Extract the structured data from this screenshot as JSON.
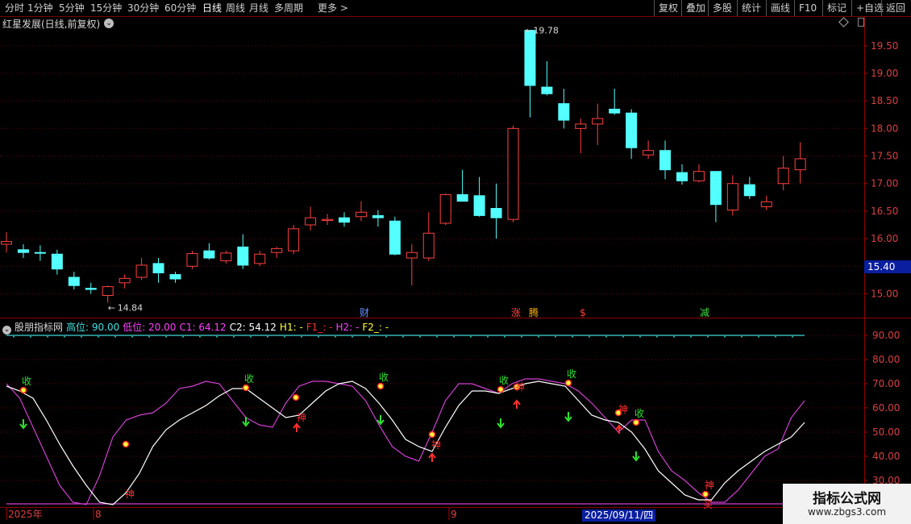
{
  "toolbar": {
    "periods": [
      {
        "label": "分时"
      },
      {
        "label": "1分钟"
      },
      {
        "label": "5分钟"
      },
      {
        "label": "15分钟"
      },
      {
        "label": "30分钟"
      },
      {
        "label": "60分钟"
      },
      {
        "label": "日线",
        "active": true
      },
      {
        "label": "周线"
      },
      {
        "label": "月线"
      },
      {
        "label": "多周期"
      },
      {
        "label": "更多 >"
      }
    ],
    "actions": [
      {
        "label": "复权"
      },
      {
        "label": "叠加"
      },
      {
        "label": "多股"
      },
      {
        "label": "统计"
      },
      {
        "label": "画线"
      },
      {
        "label": "F10"
      },
      {
        "label": "标记"
      },
      {
        "label": "+自选"
      },
      {
        "label": "返回"
      }
    ]
  },
  "stock": {
    "title": "红星发展(日线,前复权)",
    "current_price": "15.40",
    "high_label": "19.78",
    "low_label": "14.84"
  },
  "indicator": {
    "name": "股朋指标网",
    "params": [
      {
        "text": "高位: 90.00",
        "color": "#40e0e0"
      },
      {
        "text": "低位: 20.00",
        "color": "#ff40ff"
      },
      {
        "text": "C1: 64.12",
        "color": "#ff40ff"
      },
      {
        "text": "C2: 54.12",
        "color": "#ffffff"
      },
      {
        "text": "H1: -",
        "color": "#ffff40"
      },
      {
        "text": "F1_: -",
        "color": "#ff3030"
      },
      {
        "text": "H2: -",
        "color": "#ff40ff"
      },
      {
        "text": "F2_: -",
        "color": "#ffff40"
      }
    ]
  },
  "time_axis": {
    "labels": [
      "2025年",
      "8",
      "9"
    ],
    "cursor_date": "2025/09/11/四"
  },
  "event_markers": [
    {
      "text": "财",
      "color": "#6090ff"
    },
    {
      "text": "涨",
      "color": "#ff4040"
    },
    {
      "text": "腾",
      "color": "#ffb000"
    },
    {
      "text": "$",
      "color": "#ff4040"
    },
    {
      "text": "减",
      "color": "#40e040"
    }
  ],
  "signal_labels": {
    "shou": "收",
    "shen": "神",
    "mai": "买"
  },
  "watermark": {
    "title": "指标公式网",
    "url": "www.zbgs3.com"
  },
  "chart_data": [
    {
      "type": "candlestick",
      "yaxis_ticks": [
        "19.50",
        "19.00",
        "18.50",
        "18.00",
        "17.50",
        "17.00",
        "16.50",
        "16.00",
        "15.50",
        "15.00"
      ],
      "ylim": [
        14.7,
        19.95
      ],
      "candles": [
        {
          "o": 15.9,
          "h": 16.12,
          "l": 15.75,
          "c": 15.95
        },
        {
          "o": 15.8,
          "h": 15.9,
          "l": 15.65,
          "c": 15.75
        },
        {
          "o": 15.75,
          "h": 15.88,
          "l": 15.6,
          "c": 15.74
        },
        {
          "o": 15.72,
          "h": 15.8,
          "l": 15.35,
          "c": 15.45
        },
        {
          "o": 15.3,
          "h": 15.4,
          "l": 15.08,
          "c": 15.15
        },
        {
          "o": 15.1,
          "h": 15.2,
          "l": 15.0,
          "c": 15.08
        },
        {
          "o": 14.97,
          "h": 15.15,
          "l": 14.84,
          "c": 15.13
        },
        {
          "o": 15.2,
          "h": 15.35,
          "l": 15.1,
          "c": 15.28
        },
        {
          "o": 15.3,
          "h": 15.65,
          "l": 15.25,
          "c": 15.52
        },
        {
          "o": 15.55,
          "h": 15.65,
          "l": 15.2,
          "c": 15.38
        },
        {
          "o": 15.35,
          "h": 15.4,
          "l": 15.2,
          "c": 15.27
        },
        {
          "o": 15.5,
          "h": 15.78,
          "l": 15.45,
          "c": 15.73
        },
        {
          "o": 15.78,
          "h": 15.92,
          "l": 15.62,
          "c": 15.65
        },
        {
          "o": 15.6,
          "h": 15.78,
          "l": 15.55,
          "c": 15.74
        },
        {
          "o": 15.85,
          "h": 16.08,
          "l": 15.45,
          "c": 15.52
        },
        {
          "o": 15.55,
          "h": 15.78,
          "l": 15.5,
          "c": 15.72
        },
        {
          "o": 15.75,
          "h": 15.85,
          "l": 15.65,
          "c": 15.82
        },
        {
          "o": 15.78,
          "h": 16.25,
          "l": 15.72,
          "c": 16.18
        },
        {
          "o": 16.25,
          "h": 16.58,
          "l": 16.15,
          "c": 16.38
        },
        {
          "o": 16.33,
          "h": 16.45,
          "l": 16.25,
          "c": 16.35
        },
        {
          "o": 16.38,
          "h": 16.48,
          "l": 16.22,
          "c": 16.3
        },
        {
          "o": 16.4,
          "h": 16.68,
          "l": 16.32,
          "c": 16.48
        },
        {
          "o": 16.42,
          "h": 16.52,
          "l": 16.22,
          "c": 16.38
        },
        {
          "o": 16.32,
          "h": 16.4,
          "l": 15.7,
          "c": 15.72
        },
        {
          "o": 15.65,
          "h": 15.9,
          "l": 15.15,
          "c": 15.75
        },
        {
          "o": 15.65,
          "h": 16.48,
          "l": 15.6,
          "c": 16.1
        },
        {
          "o": 16.28,
          "h": 16.82,
          "l": 16.25,
          "c": 16.8
        },
        {
          "o": 16.8,
          "h": 17.25,
          "l": 16.75,
          "c": 16.68
        },
        {
          "o": 16.78,
          "h": 17.12,
          "l": 16.4,
          "c": 16.42
        },
        {
          "o": 16.55,
          "h": 17.0,
          "l": 16.0,
          "c": 16.38
        },
        {
          "o": 16.35,
          "h": 18.05,
          "l": 16.3,
          "c": 18.0
        },
        {
          "o": 19.78,
          "h": 19.78,
          "l": 18.2,
          "c": 18.78
        },
        {
          "o": 18.75,
          "h": 19.22,
          "l": 18.6,
          "c": 18.63
        },
        {
          "o": 18.45,
          "h": 18.72,
          "l": 18.0,
          "c": 18.15
        },
        {
          "o": 18.0,
          "h": 18.18,
          "l": 17.55,
          "c": 18.08
        },
        {
          "o": 18.08,
          "h": 18.45,
          "l": 17.7,
          "c": 18.18
        },
        {
          "o": 18.35,
          "h": 18.72,
          "l": 18.25,
          "c": 18.28
        },
        {
          "o": 18.28,
          "h": 18.35,
          "l": 17.45,
          "c": 17.65
        },
        {
          "o": 17.52,
          "h": 17.78,
          "l": 17.45,
          "c": 17.6
        },
        {
          "o": 17.6,
          "h": 17.78,
          "l": 17.08,
          "c": 17.25
        },
        {
          "o": 17.2,
          "h": 17.35,
          "l": 16.98,
          "c": 17.05
        },
        {
          "o": 17.05,
          "h": 17.35,
          "l": 17.02,
          "c": 17.22
        },
        {
          "o": 17.22,
          "h": 17.22,
          "l": 16.3,
          "c": 16.62
        },
        {
          "o": 16.52,
          "h": 17.15,
          "l": 16.42,
          "c": 17.0
        },
        {
          "o": 16.98,
          "h": 17.12,
          "l": 16.72,
          "c": 16.78
        },
        {
          "o": 16.58,
          "h": 16.78,
          "l": 16.52,
          "c": 16.67
        },
        {
          "o": 17.0,
          "h": 17.5,
          "l": 16.88,
          "c": 17.28
        },
        {
          "o": 17.25,
          "h": 17.75,
          "l": 17.0,
          "c": 17.45
        }
      ]
    },
    {
      "type": "line",
      "yaxis_ticks": [
        "90.00",
        "80.00",
        "70.00",
        "60.00",
        "50.00",
        "40.00",
        "30.00"
      ],
      "ylim": [
        15,
        95
      ],
      "hlines": [
        {
          "name": "高位",
          "value": 90,
          "color": "#40d8d8"
        },
        {
          "name": "低位",
          "value": 20,
          "color": "#d040d0"
        }
      ],
      "series": [
        {
          "name": "C1",
          "color": "#d040d0",
          "values": [
            70,
            64,
            52,
            40,
            28,
            21,
            20,
            32,
            48,
            55,
            57,
            58,
            62,
            68,
            69,
            71,
            70,
            63,
            56,
            53,
            52,
            62,
            69,
            71,
            71,
            70,
            69,
            63,
            53,
            44,
            40,
            38,
            50,
            63,
            70,
            70,
            68,
            66,
            70,
            72,
            72,
            71,
            70,
            67,
            62,
            56,
            50,
            55,
            55,
            42,
            34,
            30,
            25,
            21,
            21,
            26,
            33,
            40,
            43,
            56,
            63
          ]
        },
        {
          "name": "C2",
          "color": "#ffffff",
          "values": [
            69,
            67,
            64,
            55,
            45,
            36,
            28,
            21,
            20,
            25,
            33,
            44,
            51,
            55,
            58,
            61,
            65,
            68,
            68,
            64,
            60,
            56,
            57,
            62,
            67,
            70,
            71,
            68,
            62,
            55,
            47,
            44,
            42,
            52,
            61,
            67,
            67,
            66,
            68,
            70,
            71,
            70,
            69,
            63,
            57,
            55,
            54,
            50,
            43,
            34,
            29,
            24,
            22,
            22,
            29,
            34,
            38,
            42,
            45,
            48,
            54
          ]
        }
      ]
    }
  ]
}
